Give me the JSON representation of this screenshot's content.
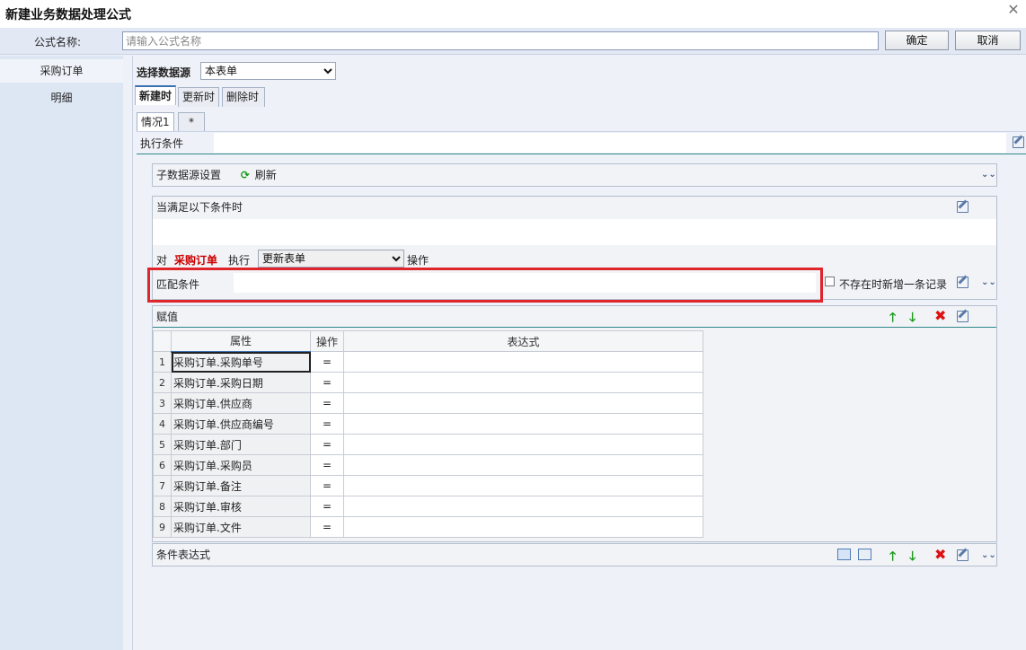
{
  "window": {
    "title": "新建业务数据处理公式",
    "close_symbol": "✕"
  },
  "namebar": {
    "label": "公式名称:",
    "placeholder": "请输入公式名称",
    "value": "",
    "ok": "确定",
    "cancel": "取消"
  },
  "sidebar": {
    "items": [
      {
        "label": "采购订单"
      },
      {
        "label": "明细"
      }
    ]
  },
  "datasource": {
    "label": "选择数据源",
    "selected": "本表单"
  },
  "event_tabs": [
    {
      "label": "新建时"
    },
    {
      "label": "更新时"
    },
    {
      "label": "删除时"
    }
  ],
  "case_tabs": [
    {
      "label": "情况1"
    },
    {
      "label": "*"
    }
  ],
  "exec_condition": {
    "label": "执行条件",
    "value": ""
  },
  "subsource": {
    "label": "子数据源设置",
    "refresh": "刷新"
  },
  "condition": {
    "label": "当满足以下条件时",
    "prefix": "对",
    "target": "采购订单",
    "exec_label": "执行",
    "action": "更新表单",
    "suffix": "操作",
    "match_label": "匹配条件",
    "match_value": "",
    "create_if_missing": "不存在时新增一条记录"
  },
  "assign": {
    "label": "赋值",
    "columns": [
      "属性",
      "操作",
      "表达式"
    ],
    "rows": [
      {
        "num": "1",
        "prop": "采购订单.采购单号",
        "op": "=",
        "expr": ""
      },
      {
        "num": "2",
        "prop": "采购订单.采购日期",
        "op": "=",
        "expr": ""
      },
      {
        "num": "3",
        "prop": "采购订单.供应商",
        "op": "=",
        "expr": ""
      },
      {
        "num": "4",
        "prop": "采购订单.供应商编号",
        "op": "=",
        "expr": ""
      },
      {
        "num": "5",
        "prop": "采购订单.部门",
        "op": "=",
        "expr": ""
      },
      {
        "num": "6",
        "prop": "采购订单.采购员",
        "op": "=",
        "expr": ""
      },
      {
        "num": "7",
        "prop": "采购订单.备注",
        "op": "=",
        "expr": ""
      },
      {
        "num": "8",
        "prop": "采购订单.审核",
        "op": "=",
        "expr": ""
      },
      {
        "num": "9",
        "prop": "采购订单.文件",
        "op": "=",
        "expr": ""
      }
    ]
  },
  "cond_expr": {
    "label": "条件表达式"
  },
  "colors": {
    "highlight_box": "#e0242c",
    "target_text": "#cc0000",
    "accent": "#3a6fb0"
  }
}
